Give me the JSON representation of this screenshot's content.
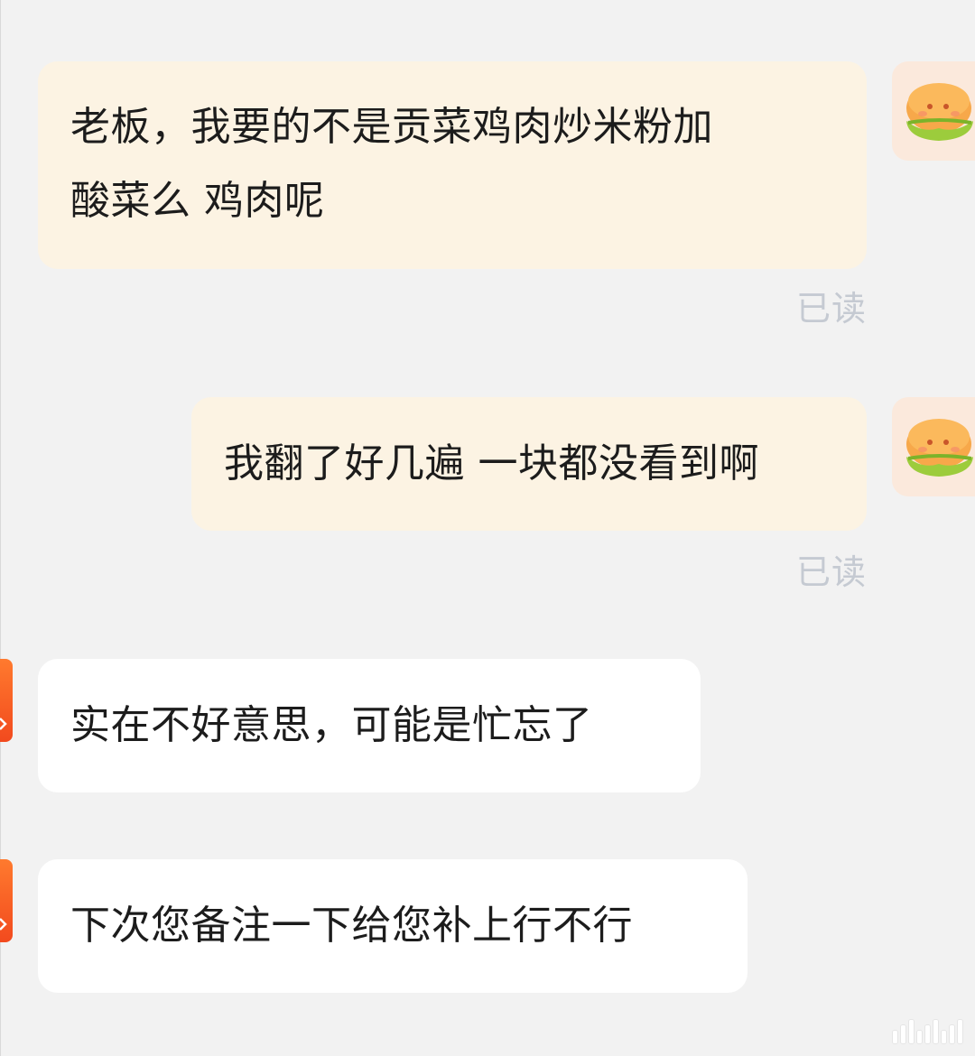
{
  "messages": [
    {
      "sender": "me",
      "lines": [
        "老板，我要的不是贡菜鸡肉炒米粉加",
        "酸菜么 鸡肉呢"
      ],
      "status": "已读"
    },
    {
      "sender": "me",
      "lines": [
        "我翻了好几遍 一块都没看到啊"
      ],
      "status": "已读"
    },
    {
      "sender": "merchant",
      "lines": [
        "实在不好意思，可能是忙忘了"
      ]
    },
    {
      "sender": "merchant",
      "lines": [
        "下次您备注一下给您补上行不行"
      ]
    }
  ],
  "avatars": {
    "me_icon": "burger-icon",
    "merchant_icon": "shop-logo-icon"
  },
  "colors": {
    "background": "#f2f2f2",
    "my_bubble": "#fcf3e3",
    "merchant_bubble": "#ffffff",
    "read_status": "#c5cad2",
    "merchant_avatar": "#f24a1e",
    "text": "#1c1c1c"
  }
}
